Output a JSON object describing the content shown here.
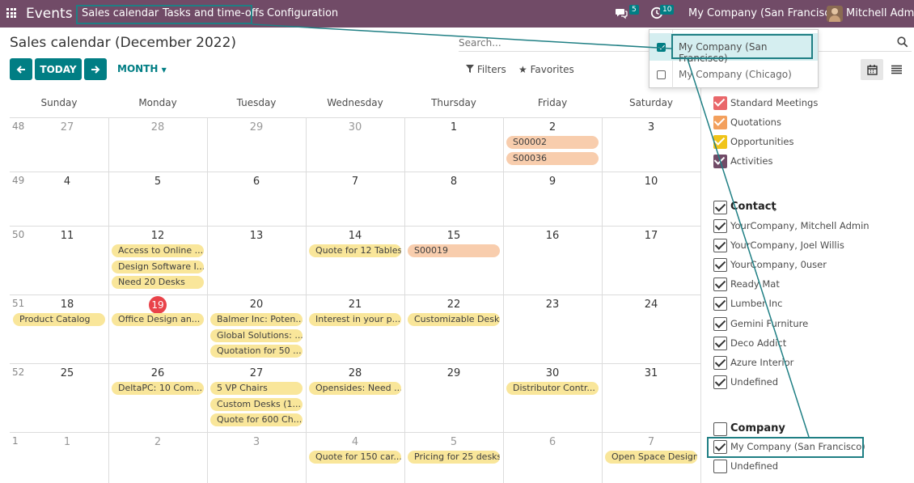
{
  "navbar": {
    "app_name": "Events",
    "menu": [
      "Sales calendar",
      "Tasks and time-offs",
      "Configuration"
    ],
    "messages_count": "5",
    "activities_count": "10",
    "company_switcher": "My Company (San Francisco)",
    "user_name": "Mitchell Admin",
    "icons": [
      "apps-grid-icon",
      "chat-icon",
      "clock-icon"
    ]
  },
  "control": {
    "title": "Sales calendar (December 2022)",
    "search_placeholder": "Search...",
    "today": "TODAY",
    "scale": "MONTH",
    "filters": "Filters",
    "favorites": "Favorites"
  },
  "calendar": {
    "days": [
      "Sunday",
      "Monday",
      "Tuesday",
      "Wednesday",
      "Thursday",
      "Friday",
      "Saturday"
    ],
    "weeks": [
      {
        "num": "48",
        "dates": [
          "27",
          "28",
          "29",
          "30",
          "1",
          "2",
          "3"
        ],
        "other": [
          true,
          true,
          true,
          true,
          false,
          false,
          false
        ]
      },
      {
        "num": "49",
        "dates": [
          "4",
          "5",
          "6",
          "7",
          "8",
          "9",
          "10"
        ],
        "other": [
          false,
          false,
          false,
          false,
          false,
          false,
          false
        ]
      },
      {
        "num": "50",
        "dates": [
          "11",
          "12",
          "13",
          "14",
          "15",
          "16",
          "17"
        ],
        "other": [
          false,
          false,
          false,
          false,
          false,
          false,
          false
        ]
      },
      {
        "num": "51",
        "dates": [
          "18",
          "19",
          "20",
          "21",
          "22",
          "23",
          "24"
        ],
        "other": [
          false,
          false,
          false,
          false,
          false,
          false,
          false
        ]
      },
      {
        "num": "52",
        "dates": [
          "25",
          "26",
          "27",
          "28",
          "29",
          "30",
          "31"
        ],
        "other": [
          false,
          false,
          false,
          false,
          false,
          false,
          false
        ]
      },
      {
        "num": "1",
        "dates": [
          "1",
          "2",
          "3",
          "4",
          "5",
          "6",
          "7"
        ],
        "other": [
          true,
          true,
          true,
          true,
          true,
          true,
          true
        ]
      }
    ],
    "today": "19",
    "events": [
      {
        "week": 0,
        "day": 5,
        "slot": 0,
        "text": "S00002",
        "color": "o"
      },
      {
        "week": 0,
        "day": 5,
        "slot": 1,
        "text": "S00036",
        "color": "o"
      },
      {
        "week": 2,
        "day": 1,
        "slot": 0,
        "text": "Access to Online ...",
        "color": "y"
      },
      {
        "week": 2,
        "day": 1,
        "slot": 1,
        "text": "Design Software I...",
        "color": "y"
      },
      {
        "week": 2,
        "day": 1,
        "slot": 2,
        "text": "Need 20 Desks",
        "color": "y"
      },
      {
        "week": 2,
        "day": 3,
        "slot": 0,
        "text": "Quote for 12 Tables",
        "color": "y"
      },
      {
        "week": 2,
        "day": 4,
        "slot": 0,
        "text": "S00019",
        "color": "o"
      },
      {
        "week": 3,
        "day": 0,
        "slot": 0,
        "text": "Product Catalog",
        "color": "y"
      },
      {
        "week": 3,
        "day": 1,
        "slot": 0,
        "text": "Office Design an...",
        "color": "y"
      },
      {
        "week": 3,
        "day": 2,
        "slot": 0,
        "text": "Balmer Inc: Poten...",
        "color": "y"
      },
      {
        "week": 3,
        "day": 2,
        "slot": 1,
        "text": "Global Solutions: ...",
        "color": "y"
      },
      {
        "week": 3,
        "day": 2,
        "slot": 2,
        "text": "Quotation for 50 ...",
        "color": "y"
      },
      {
        "week": 3,
        "day": 3,
        "slot": 0,
        "text": "Interest in your p...",
        "color": "y"
      },
      {
        "week": 3,
        "day": 4,
        "slot": 0,
        "text": "Customizable Desk",
        "color": "y"
      },
      {
        "week": 4,
        "day": 1,
        "slot": 0,
        "text": "DeltaPC: 10 Com...",
        "color": "y"
      },
      {
        "week": 4,
        "day": 2,
        "slot": 0,
        "text": "5 VP Chairs",
        "color": "y"
      },
      {
        "week": 4,
        "day": 2,
        "slot": 1,
        "text": "Custom Desks (1...",
        "color": "y"
      },
      {
        "week": 4,
        "day": 2,
        "slot": 2,
        "text": "Quote for 600 Ch...",
        "color": "y"
      },
      {
        "week": 4,
        "day": 3,
        "slot": 0,
        "text": "Opensides: Need ...",
        "color": "y"
      },
      {
        "week": 4,
        "day": 5,
        "slot": 0,
        "text": "Distributor Contr...",
        "color": "y"
      },
      {
        "week": 5,
        "day": 3,
        "slot": 0,
        "text": "Quote for 150 car...",
        "color": "y"
      },
      {
        "week": 5,
        "day": 4,
        "slot": 0,
        "text": "Pricing for 25 desks",
        "color": "y"
      },
      {
        "week": 5,
        "day": 6,
        "slot": 0,
        "text": "Open Space Design",
        "color": "y"
      }
    ]
  },
  "sidebar": {
    "types": [
      {
        "label": "Standard Meetings",
        "color": "#e9676a"
      },
      {
        "label": "Quotations",
        "color": "#f3a05d"
      },
      {
        "label": "Opportunities",
        "color": "#f0c419"
      },
      {
        "label": "Activities",
        "color": "#714b67"
      }
    ],
    "contact_heading": "Contact",
    "contacts": [
      "YourCompany, Mitchell Admin",
      "YourCompany, Joel Willis",
      "YourCompany, 0user",
      "Ready Mat",
      "Lumber Inc",
      "Gemini Furniture",
      "Deco Addict",
      "Azure Interior",
      "Undefined"
    ],
    "company_heading": "Company",
    "companies": [
      {
        "label": "My Company (San Francisco)",
        "checked": true
      },
      {
        "label": "Undefined",
        "checked": false
      }
    ]
  },
  "company_dropdown": {
    "items": [
      {
        "label": "My Company (San Francisco)",
        "checked": true
      },
      {
        "label": "My Company (Chicago)",
        "checked": false
      }
    ]
  },
  "colors": {
    "navbar": "#714b67",
    "primary": "#017e84",
    "highlight": "#1f7f84",
    "today": "#e9434a"
  }
}
